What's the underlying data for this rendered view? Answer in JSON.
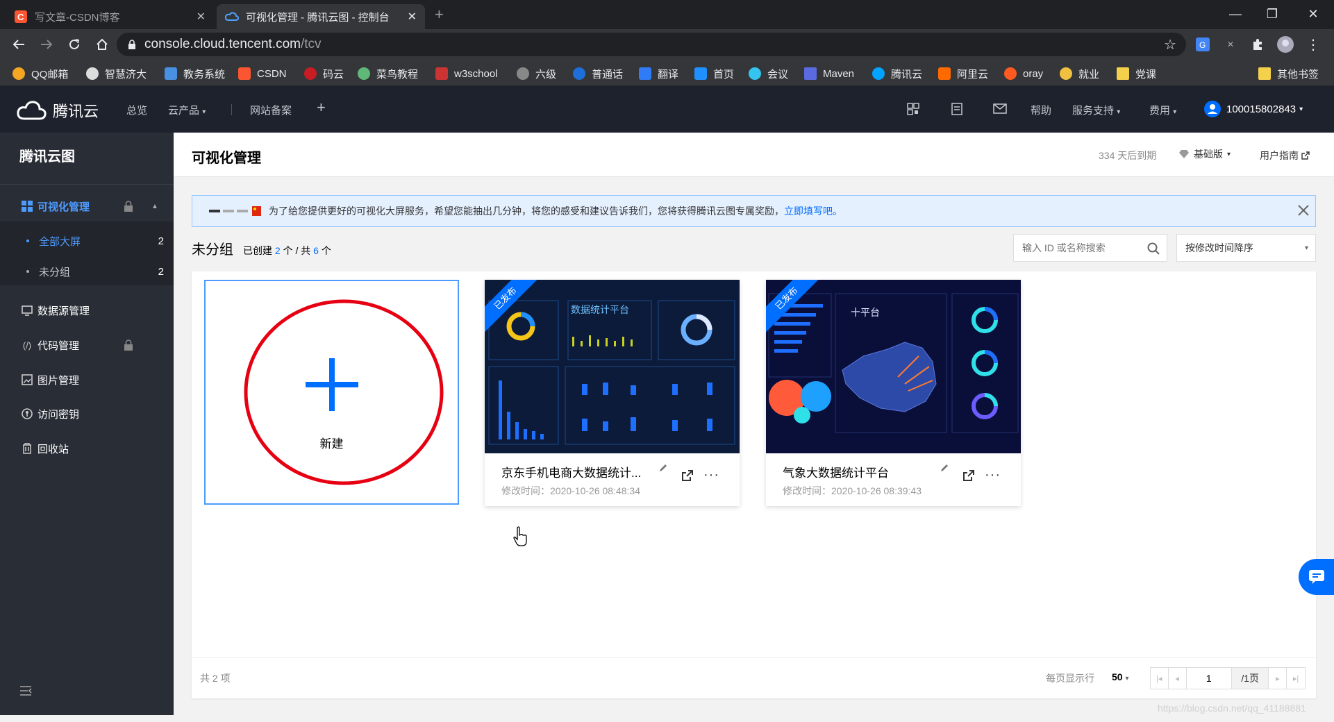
{
  "browser": {
    "tabs": [
      {
        "title": "写文章-CSDN博客",
        "active": false
      },
      {
        "title": "可视化管理 - 腾讯云图 - 控制台",
        "active": true
      }
    ],
    "url_host": "console.cloud.tencent.com",
    "url_path": "/tcv",
    "bookmarks": [
      {
        "label": "QQ邮箱",
        "color": "#f5a623"
      },
      {
        "label": "智慧济大",
        "color": "#ffffff"
      },
      {
        "label": "教务系统",
        "color": "#4a90e2"
      },
      {
        "label": "CSDN",
        "color": "#fc5531"
      },
      {
        "label": "码云",
        "color": "#c71d23"
      },
      {
        "label": "菜鸟教程",
        "color": "#5fb878"
      },
      {
        "label": "w3school",
        "color": "#cc3333"
      },
      {
        "label": "六级",
        "color": "#888888"
      },
      {
        "label": "普通话",
        "color": "#1e6fd9"
      },
      {
        "label": "翻译",
        "color": "#2f7cf6"
      },
      {
        "label": "首页",
        "color": "#1e90ff"
      },
      {
        "label": "会议",
        "color": "#35c3f0"
      },
      {
        "label": "Maven",
        "color": "#5a6be0"
      },
      {
        "label": "腾讯云",
        "color": "#00a3ff"
      },
      {
        "label": "阿里云",
        "color": "#ff6a00"
      },
      {
        "label": "oray",
        "color": "#ff5a1f"
      },
      {
        "label": "就业",
        "color": "#f0c040"
      },
      {
        "label": "党课",
        "color": "#f5d04a"
      }
    ],
    "other_bookmarks": "其他书签"
  },
  "topbar": {
    "brand": "腾讯云",
    "nav": [
      "总览",
      "云产品",
      "网站备案"
    ],
    "help": "帮助",
    "support": "服务支持",
    "fees": "费用",
    "account": "100015802843"
  },
  "sidebar": {
    "title": "腾讯云图",
    "items": [
      {
        "label": "可视化管理",
        "icon": "grid-icon",
        "active": true,
        "locked": true
      },
      {
        "label": "数据源管理",
        "icon": "monitor-icon",
        "locked": false
      },
      {
        "label": "代码管理",
        "icon": "code-icon",
        "locked": true
      },
      {
        "label": "图片管理",
        "icon": "image-icon",
        "locked": false
      },
      {
        "label": "访问密钥",
        "icon": "key-icon",
        "locked": false
      },
      {
        "label": "回收站",
        "icon": "trash-icon",
        "locked": false
      }
    ],
    "subitems": [
      {
        "label": "全部大屏",
        "count": "2"
      },
      {
        "label": "未分组",
        "count": "2"
      }
    ]
  },
  "main": {
    "page_title": "可视化管理",
    "expire_text": "334 天后到期",
    "edition": "基础版",
    "guide": "用户指南",
    "notice_text": "为了给您提供更好的可视化大屏服务，希望您能抽出几分钟，将您的感受和建议告诉我们，您将获得腾讯云图专属奖励，",
    "notice_link": "立即填写吧。",
    "group_title": "未分组",
    "created_prefix": "已创建",
    "created_count": "2",
    "created_mid": "个 / 共",
    "total_count": "6",
    "created_suffix": "个",
    "search_placeholder": "输入 ID 或名称搜索",
    "sort_label": "按修改时间降序",
    "new_label": "新建",
    "cards": [
      {
        "title": "京东手机电商大数据统计...",
        "time": "修改时间：2020-10-26 08:48:34",
        "status": "已发布",
        "thumb_title": "数据统计平台"
      },
      {
        "title": "气象大数据统计平台",
        "time": "修改时间：2020-10-26 08:39:43",
        "status": "已发布",
        "thumb_title": "十平台"
      }
    ],
    "footer_total": "共 2 项",
    "per_page_label": "每页显示行",
    "per_page": "50",
    "page_input": "1",
    "page_total": "/1页"
  },
  "colors": {
    "accent": "#006eff",
    "annotation": "#e60012"
  },
  "watermark": "https://blog.csdn.net/qq_41188881"
}
